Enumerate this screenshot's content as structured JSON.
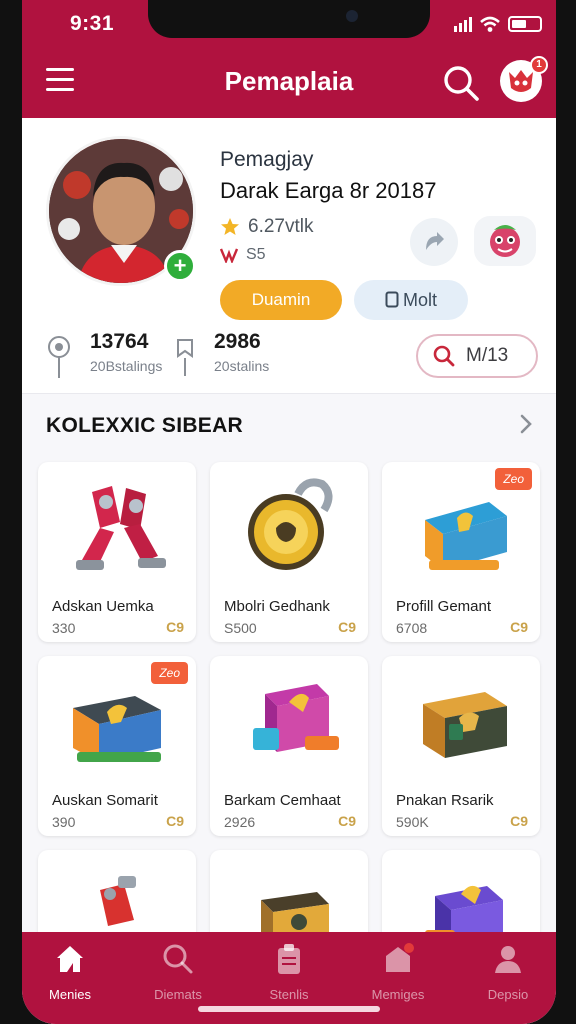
{
  "status_bar": {
    "time": "9:31"
  },
  "header": {
    "title": "Pemaplaia",
    "notification_count": "1"
  },
  "profile": {
    "username": "Pemagjay",
    "subtitle": "Darak Earga 8r 20187",
    "rating": "6.27vtlk",
    "rank": "S5",
    "primary_button": "Duamin",
    "secondary_button": "Molt"
  },
  "stats": [
    {
      "value": "13764",
      "label": "20Bstalings"
    },
    {
      "value": "2986",
      "label": "20stalins"
    }
  ],
  "filter": {
    "label": "M/13"
  },
  "section": {
    "title": "KOLEXXIC SIBEAR"
  },
  "items": [
    {
      "name": "Adskan Uemka",
      "price": "330",
      "coin": "C9"
    },
    {
      "name": "Mbolri Gedhank",
      "price": "S500",
      "coin": "C9"
    },
    {
      "name": "Profill Gemant",
      "price": "6708",
      "coin": "C9",
      "tag": "Zeo"
    },
    {
      "name": "Auskan Somarit",
      "price": "390",
      "coin": "C9",
      "tag": "Zeo"
    },
    {
      "name": "Barkam Cemhaat",
      "price": "2926",
      "coin": "C9"
    },
    {
      "name": "Pnakan Rsarik",
      "price": "590K",
      "coin": "C9"
    }
  ],
  "nav": [
    {
      "label": "Menies",
      "active": true
    },
    {
      "label": "Diemats"
    },
    {
      "label": "Stenlis"
    },
    {
      "label": "Memiges"
    },
    {
      "label": "Depsio"
    }
  ],
  "colors": {
    "brand": "#b0123f",
    "accent": "#f2aa26",
    "success": "#2fae3b"
  }
}
